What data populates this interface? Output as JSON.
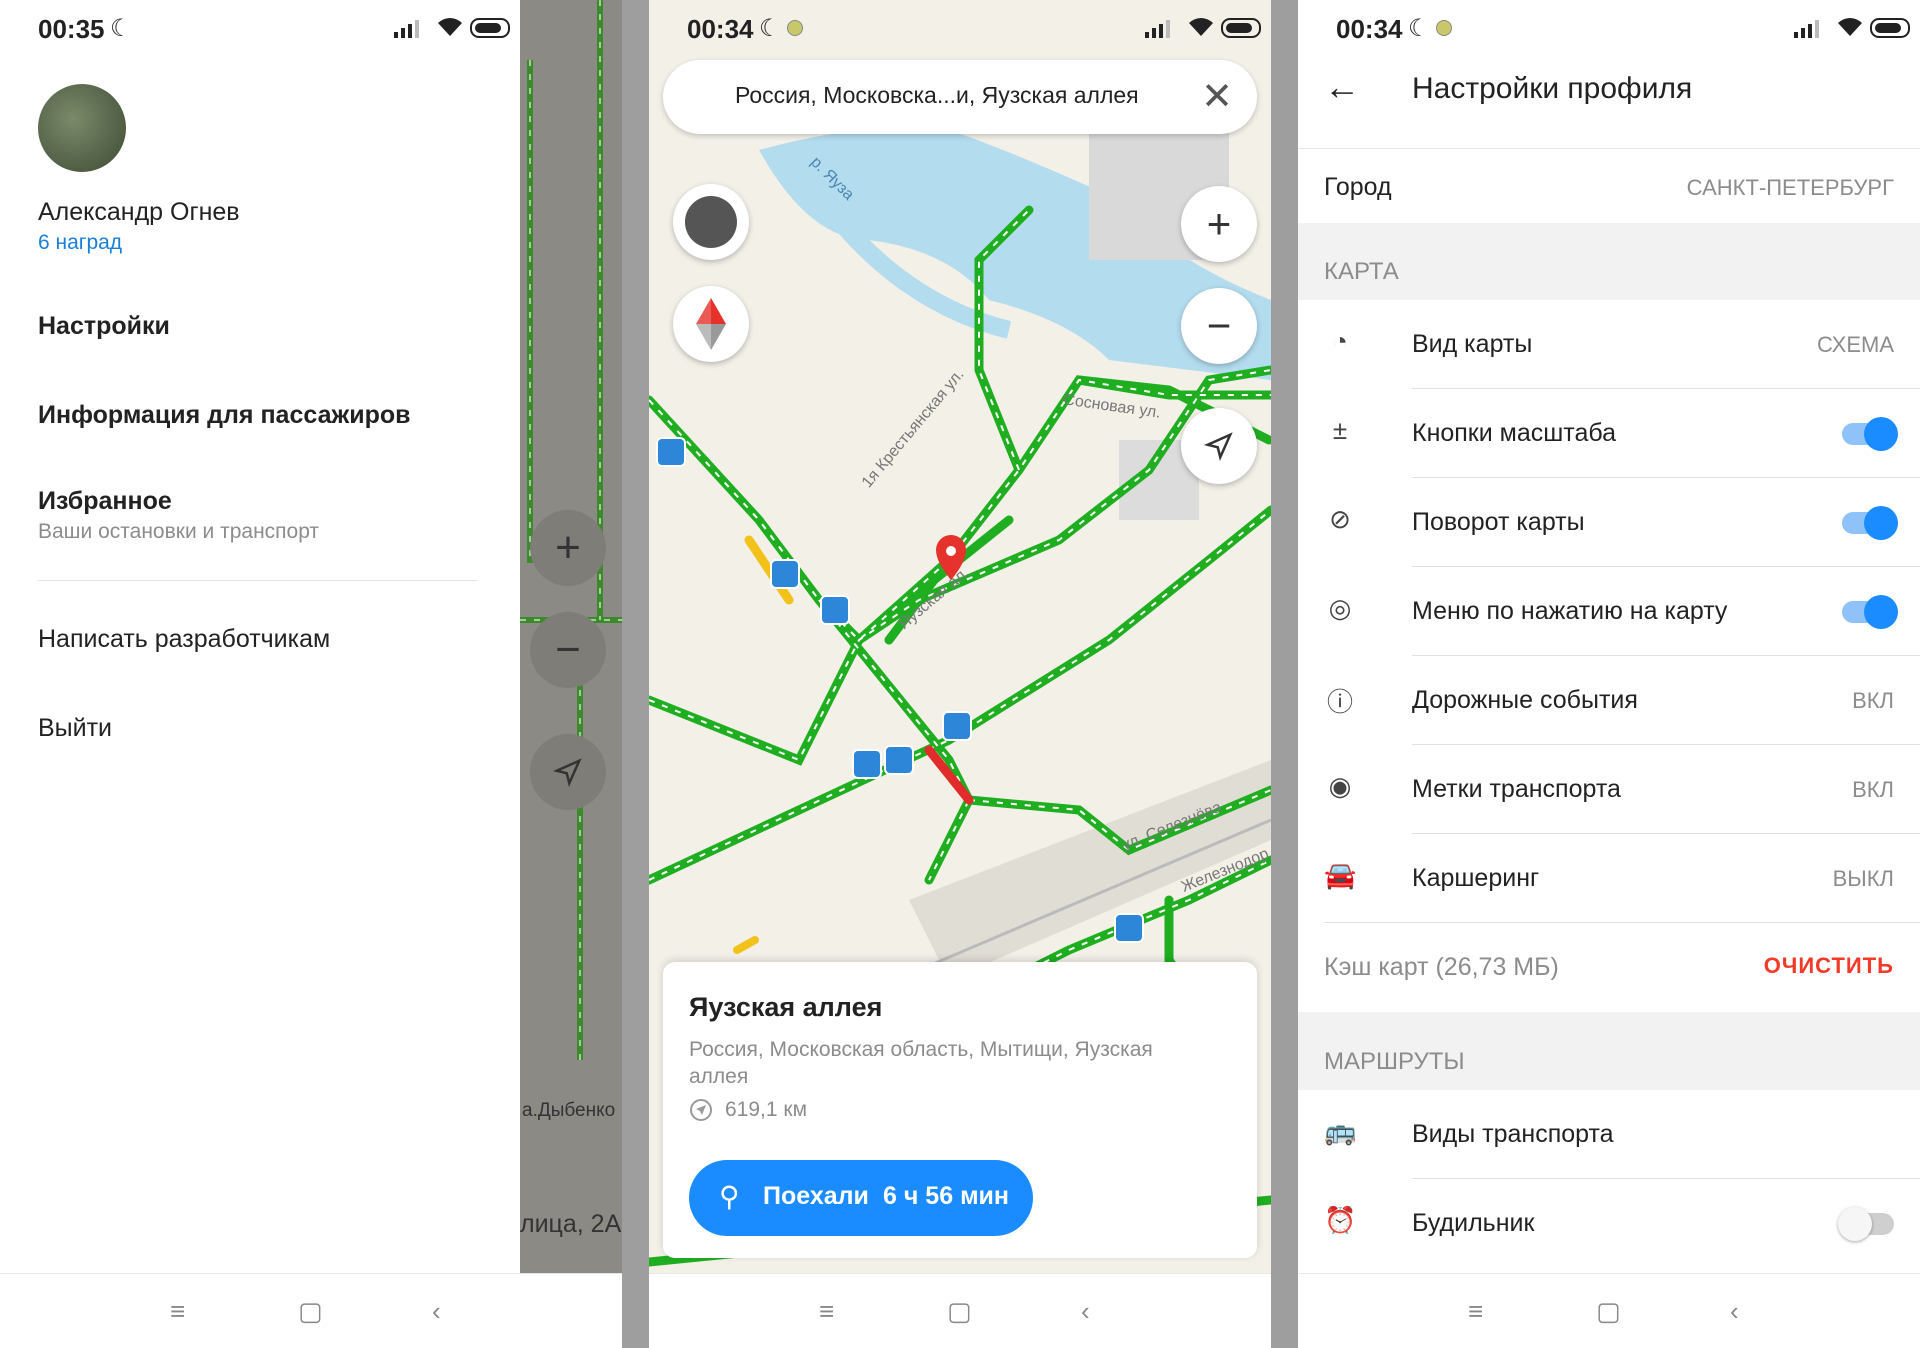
{
  "status": {
    "left_time": "00:35",
    "middle_time": "00:34",
    "right_time": "00:34"
  },
  "drawer": {
    "user_name": "Александр Огнев",
    "awards": "6 наград",
    "items": [
      {
        "label": "Настройки"
      },
      {
        "label": "Информация для пассажиров"
      },
      {
        "label": "Избранное",
        "sub": "Ваши остановки и транспорт"
      },
      {
        "label": "Написать разработчикам"
      },
      {
        "label": "Выйти"
      }
    ],
    "map_address": "лица, 2А",
    "metro": "а.Дыбенко"
  },
  "map": {
    "search_text": "Россия, Московска...и, Яузская аллея",
    "streets": [
      "р. Яуза",
      "1я Крестьянская ул.",
      "Сосновая ул.",
      "Яузская ал.",
      "ул. Селезнёва",
      "Железнодор"
    ],
    "card": {
      "title": "Яузская аллея",
      "address": "Россия, Московская область, Мытищи, Яузская аллея",
      "distance": "619,1 км",
      "go_label": "Поехали",
      "go_time": "6 ч 56 мин"
    }
  },
  "settings": {
    "title": "Настройки профиля",
    "city_label": "Город",
    "city_value": "САНКТ-ПЕТЕРБУРГ",
    "section_map": "КАРТА",
    "rows": [
      {
        "icon": "map-type-icon",
        "label": "Вид карты",
        "value": "СХЕМА"
      },
      {
        "icon": "zoom-buttons-icon",
        "label": "Кнопки масштаба",
        "toggle": true
      },
      {
        "icon": "compass-icon",
        "label": "Поворот карты",
        "toggle": true
      },
      {
        "icon": "target-icon",
        "label": "Меню по нажатию на карту",
        "toggle": true
      },
      {
        "icon": "alert-icon",
        "label": "Дорожные события",
        "value": "ВКЛ"
      },
      {
        "icon": "transport-marker-icon",
        "label": "Метки транспорта",
        "value": "ВКЛ"
      },
      {
        "icon": "car-icon",
        "label": "Каршеринг",
        "value": "ВЫКЛ"
      }
    ],
    "cache_label": "Кэш карт (26,73 МБ)",
    "cache_action": "ОЧИСТИТЬ",
    "accent_color": "#f33a28",
    "section_routes": "МАРШРУТЫ",
    "route_rows": [
      {
        "icon": "bus-icon",
        "label": "Виды транспорта"
      },
      {
        "icon": "alarm-icon",
        "label": "Будильник",
        "toggle": false
      }
    ]
  }
}
